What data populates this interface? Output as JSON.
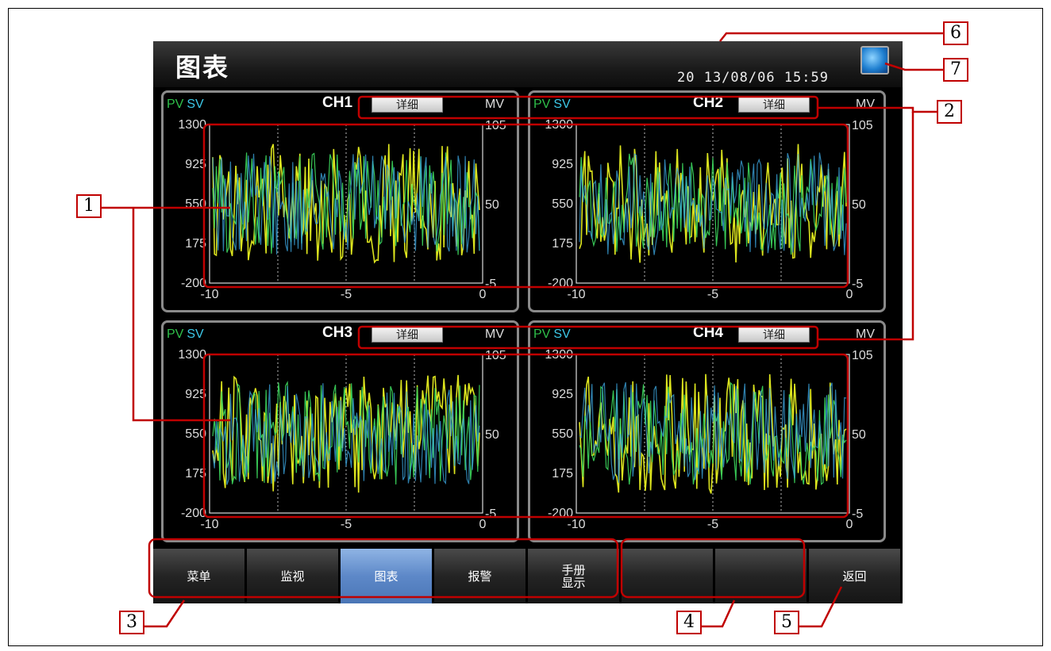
{
  "title": "图表",
  "datetime": "20 13/08/06  15:59",
  "globe_icon": "globe-icon",
  "panels": [
    {
      "pv": "PV",
      "sv": "SV",
      "ch": "CH1",
      "detail": "详细",
      "mv": "MV",
      "y_left": [
        "1300",
        "925",
        "550",
        "175",
        "-200"
      ],
      "y_right": [
        "105",
        "50",
        "-5"
      ],
      "x": [
        "-10",
        "-5",
        "0"
      ]
    },
    {
      "pv": "PV",
      "sv": "SV",
      "ch": "CH2",
      "detail": "详细",
      "mv": "MV",
      "y_left": [
        "1300",
        "925",
        "550",
        "175",
        "-200"
      ],
      "y_right": [
        "105",
        "50",
        "-5"
      ],
      "x": [
        "-10",
        "-5",
        "0"
      ]
    },
    {
      "pv": "PV",
      "sv": "SV",
      "ch": "CH3",
      "detail": "详细",
      "mv": "MV",
      "y_left": [
        "1300",
        "925",
        "550",
        "175",
        "-200"
      ],
      "y_right": [
        "105",
        "50",
        "-5"
      ],
      "x": [
        "-10",
        "-5",
        "0"
      ]
    },
    {
      "pv": "PV",
      "sv": "SV",
      "ch": "CH4",
      "detail": "详细",
      "mv": "MV",
      "y_left": [
        "1300",
        "925",
        "550",
        "175",
        "-200"
      ],
      "y_right": [
        "105",
        "50",
        "-5"
      ],
      "x": [
        "-10",
        "-5",
        "0"
      ]
    }
  ],
  "buttons": [
    {
      "label": "菜单",
      "active": false
    },
    {
      "label": "监视",
      "active": false
    },
    {
      "label": "图表",
      "active": true
    },
    {
      "label": "报警",
      "active": false
    },
    {
      "label": "手册\n显示",
      "active": false
    },
    {
      "label": "",
      "active": false
    },
    {
      "label": "",
      "active": false
    },
    {
      "label": "",
      "active": false
    },
    {
      "label": "返回",
      "active": false
    }
  ],
  "callouts": [
    "1",
    "2",
    "3",
    "4",
    "5",
    "6",
    "7"
  ],
  "colors": {
    "pv": "#2fbf4a",
    "sv": "#3cc8e8",
    "trend_yellow": "#e8f020",
    "trend_green": "#3ad05a",
    "trend_cyan": "#3aa0d8",
    "active_button": "#5d88c8",
    "callout_red": "#c00000"
  }
}
